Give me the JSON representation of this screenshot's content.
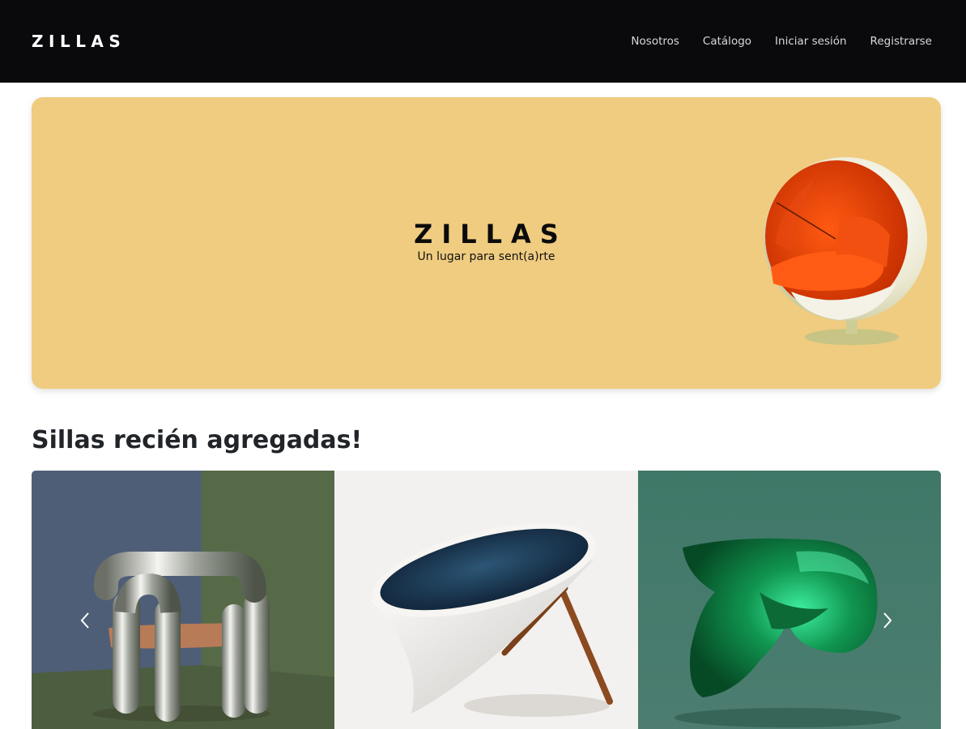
{
  "navbar": {
    "brand": "ZILLAS",
    "links": [
      "Nosotros",
      "Catálogo",
      "Iniciar sesión",
      "Registrarse"
    ]
  },
  "hero": {
    "title": "ZILLAS",
    "subtitle": "Un lugar para sent(a)rte",
    "background_color": "#efcc80"
  },
  "section": {
    "title": "Sillas recién agregadas!"
  },
  "carousel": {
    "slides": [
      {
        "name": "chrome-tube-chair",
        "background": "two-tone blue and olive green"
      },
      {
        "name": "blue-cone-chair",
        "background": "off-white"
      },
      {
        "name": "green-sculptural-chair",
        "background": "teal green"
      }
    ],
    "prev_icon": "chevron-left-icon",
    "next_icon": "chevron-right-icon"
  }
}
